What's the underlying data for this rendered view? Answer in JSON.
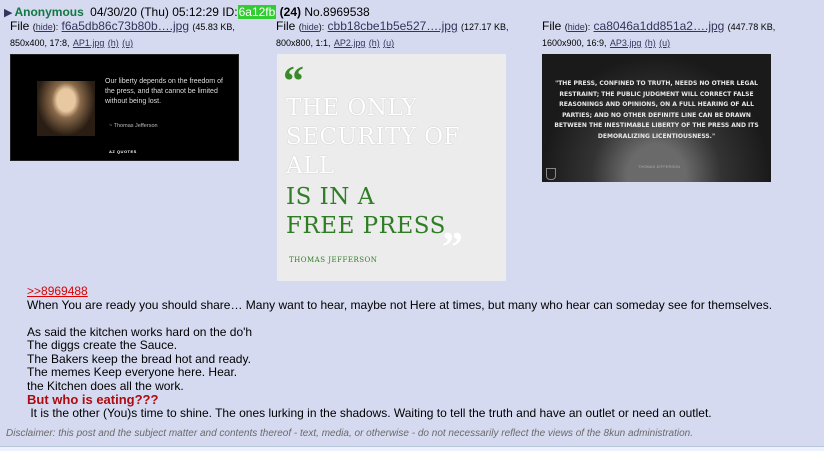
{
  "post": {
    "name": "Anonymous",
    "datetime": "04/30/20 (Thu) 05:12:29",
    "id_label": "ID:",
    "id": "6a12fb",
    "count": "(24)",
    "post_number": "No.8969538"
  },
  "files": [
    {
      "label": "File",
      "hide": "hide",
      "filename": "f6a5db86c73b80b….jpg",
      "size": "(45.83 KB,",
      "dims": "850x400, 17:8,",
      "orig": "AP1.jpg",
      "h": "(h)",
      "u": "(u)",
      "thumb": {
        "quote": "Our liberty depends on the freedom of the press, and that cannot be limited without being lost.",
        "author": "~ Thomas Jefferson",
        "brand": "AZ QUOTES"
      }
    },
    {
      "label": "File",
      "hide": "hide",
      "filename": "cbb18cbe1b5e527….jpg",
      "size": "(127.17 KB,",
      "dims": "800x800, 1:1,",
      "orig": "AP2.jpg",
      "h": "(h)",
      "u": "(u)",
      "thumb": {
        "line1": "THE ONLY",
        "line2": "SECURITY OF",
        "line3": "ALL",
        "line4": "IS IN A",
        "line5": "FREE PRESS",
        "author": "THOMAS JEFFERSON"
      }
    },
    {
      "label": "File",
      "hide": "hide",
      "filename": "ca8046a1dd851a2….jpg",
      "size": "(447.78 KB,",
      "dims": "1600x900, 16:9,",
      "orig": "AP3.jpg",
      "h": "(h)",
      "u": "(u)",
      "thumb": {
        "text": "\"THE PRESS, CONFINED TO TRUTH, NEEDS NO OTHER LEGAL RESTRAINT; THE PUBLIC JUDGMENT WILL CORRECT FALSE REASONINGS AND OPINIONS, ON A FULL HEARING OF ALL PARTIES; AND NO OTHER DEFINITE LINE CAN BE DRAWN BETWEEN THE INESTIMABLE LIBERTY OF THE PRESS AND ITS DEMORALIZING LICENTIOUSNESS.\"",
        "author": "THOMAS JEFFERSON"
      }
    }
  ],
  "body": {
    "quote_link": ">>8969488",
    "line1": "When You are ready you should share… Many want to hear, maybe not Here at times, but many who hear can someday see for themselves.",
    "line2": "As said the kitchen works hard on the do'h",
    "line3": "The diggs create the Sauce.",
    "line4": "The Bakers keep the bread hot and ready.",
    "line5": "The memes Keep everyone here. Hear.",
    "line6": "the Kitchen does all the work.",
    "red_line": "But who is eating???",
    "line7": " It is the other (You)s time to shine. The ones lurking in the shadows. Waiting to tell the truth and have an outlet or need an outlet."
  },
  "disclaimer": "Disclaimer: this post and the subject matter and contents thereof - text, media, or otherwise - do not necessarily reflect the views of the 8kun administration.",
  "colors": {
    "post_bg": "#d6daf0",
    "name": "#117743",
    "id_bg": "#32cd32",
    "quote_link": "#dd0000",
    "red_text": "#af0a0f"
  },
  "icons": [
    "post-menu-triangle-icon"
  ]
}
